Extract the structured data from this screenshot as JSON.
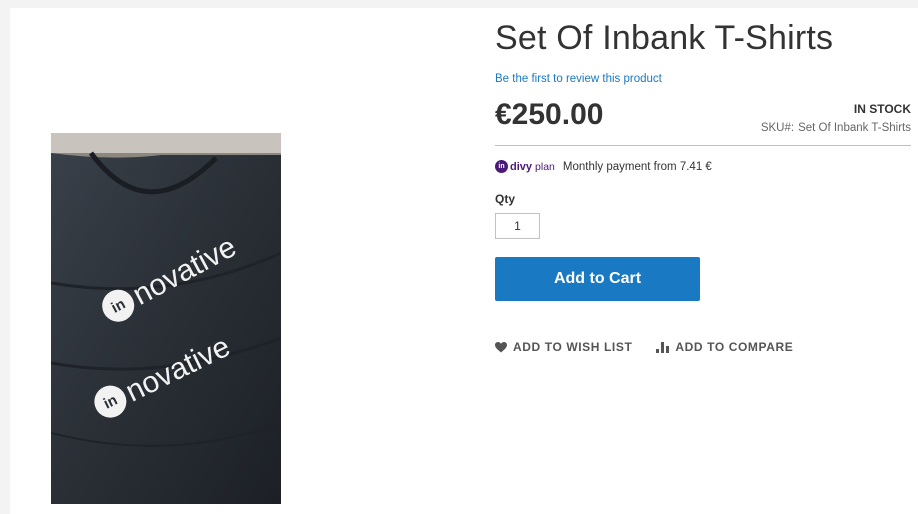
{
  "product": {
    "title": "Set Of Inbank T-Shirts",
    "review_link": "Be the first to review this product",
    "price": "€250.00",
    "stock_status": "IN STOCK",
    "sku_label": "SKU#:",
    "sku_value": "Set Of Inbank T-Shirts"
  },
  "media": {
    "print_text": "novative",
    "logo_text": "in"
  },
  "financing": {
    "logo_word": "divy",
    "logo_sub": "plan",
    "text": "Monthly payment from 7.41 €"
  },
  "qty": {
    "label": "Qty",
    "value": "1"
  },
  "buttons": {
    "add_to_cart": "Add to Cart",
    "wish_list": "ADD TO WISH LIST",
    "compare": "ADD TO COMPARE"
  },
  "colors": {
    "accent": "#1979c3",
    "divy": "#4a1a7a",
    "shirt": "#2b3037"
  },
  "icons": [
    "heart-icon",
    "compare-bars-icon",
    "divy-logo-icon"
  ]
}
